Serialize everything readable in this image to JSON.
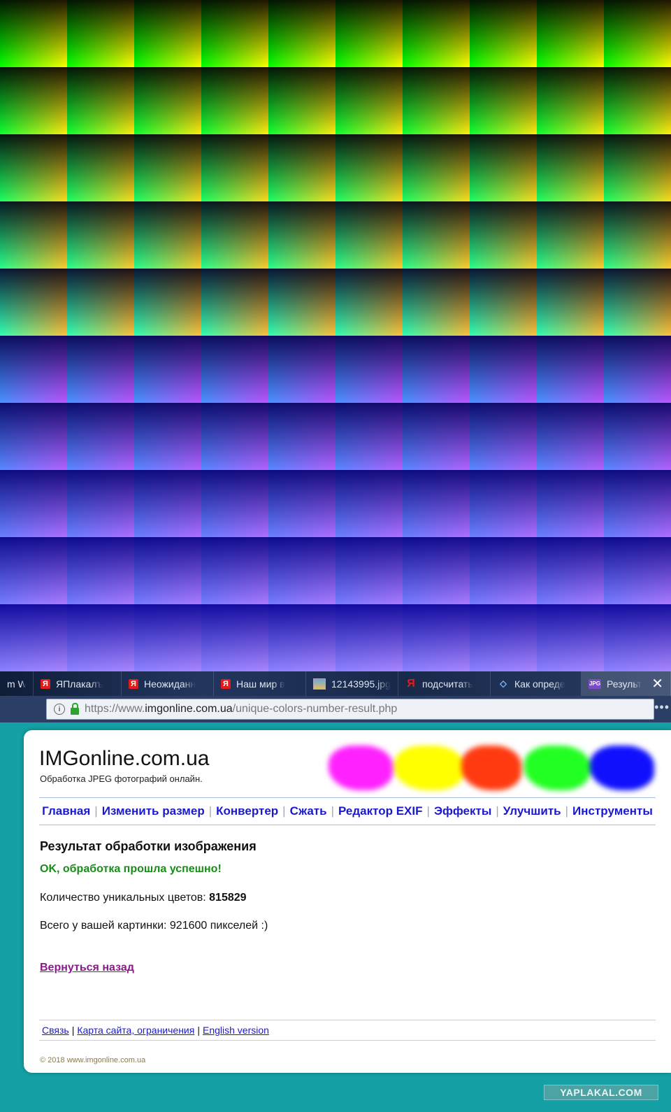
{
  "tabs": [
    {
      "label": "m W",
      "icon": "none",
      "icon_name": "none",
      "width": 48
    },
    {
      "label": "ЯПлакалъ",
      "icon": "ya-badge",
      "icon_name": "yaplakal-icon",
      "width": 126
    },
    {
      "label": "Неожиданн",
      "icon": "ya-badge",
      "icon_name": "yaplakal-icon",
      "width": 132
    },
    {
      "label": "Наш мир в",
      "icon": "ya-badge",
      "icon_name": "yaplakal-icon",
      "width": 132
    },
    {
      "label": "12143995.jpg",
      "icon": "img-ico",
      "icon_name": "image-icon",
      "width": 132
    },
    {
      "label": "подсчитать",
      "icon": "ya",
      "icon_name": "yandex-icon",
      "glyph": "Я",
      "width": 132
    },
    {
      "label": "Как опреде",
      "icon": "diamond",
      "icon_name": "diamond-icon",
      "glyph": "⬦",
      "width": 130
    },
    {
      "label": "Результат",
      "icon": "jpg-ico",
      "icon_name": "jpg-icon",
      "glyph": "JPG",
      "width": 128,
      "active": true
    }
  ],
  "url": {
    "host_prefix": "https://www.",
    "host": "imgonline.com.ua",
    "path": "/unique-colors-number-result.php",
    "more": "•••"
  },
  "site": {
    "title": "IMGonline.com.ua",
    "subtitle": "Обработка JPEG фотографий онлайн."
  },
  "blob_colors": [
    "#ff22ff",
    "#ffff00",
    "#ff3a10",
    "#22ff22",
    "#1010ff"
  ],
  "nav": [
    "Главная",
    "Изменить размер",
    "Конвертер",
    "Сжать",
    "Редактор EXIF",
    "Эффекты",
    "Улучшить",
    "Инструменты"
  ],
  "result": {
    "heading": "Результат обработки изображения",
    "ok": "OK, обработка прошла успешно!",
    "count_label": "Количество уникальных цветов: ",
    "count_value": "815829",
    "total": "Всего у вашей картинки: 921600 пикселей :)",
    "back": "Вернуться назад"
  },
  "footer": {
    "links": [
      "Связь",
      "Карта сайта, ограничения",
      "English version"
    ],
    "copyright": "© 2018 www.imgonline.com.ua"
  },
  "watermark": "YAPLAKAL.COM"
}
